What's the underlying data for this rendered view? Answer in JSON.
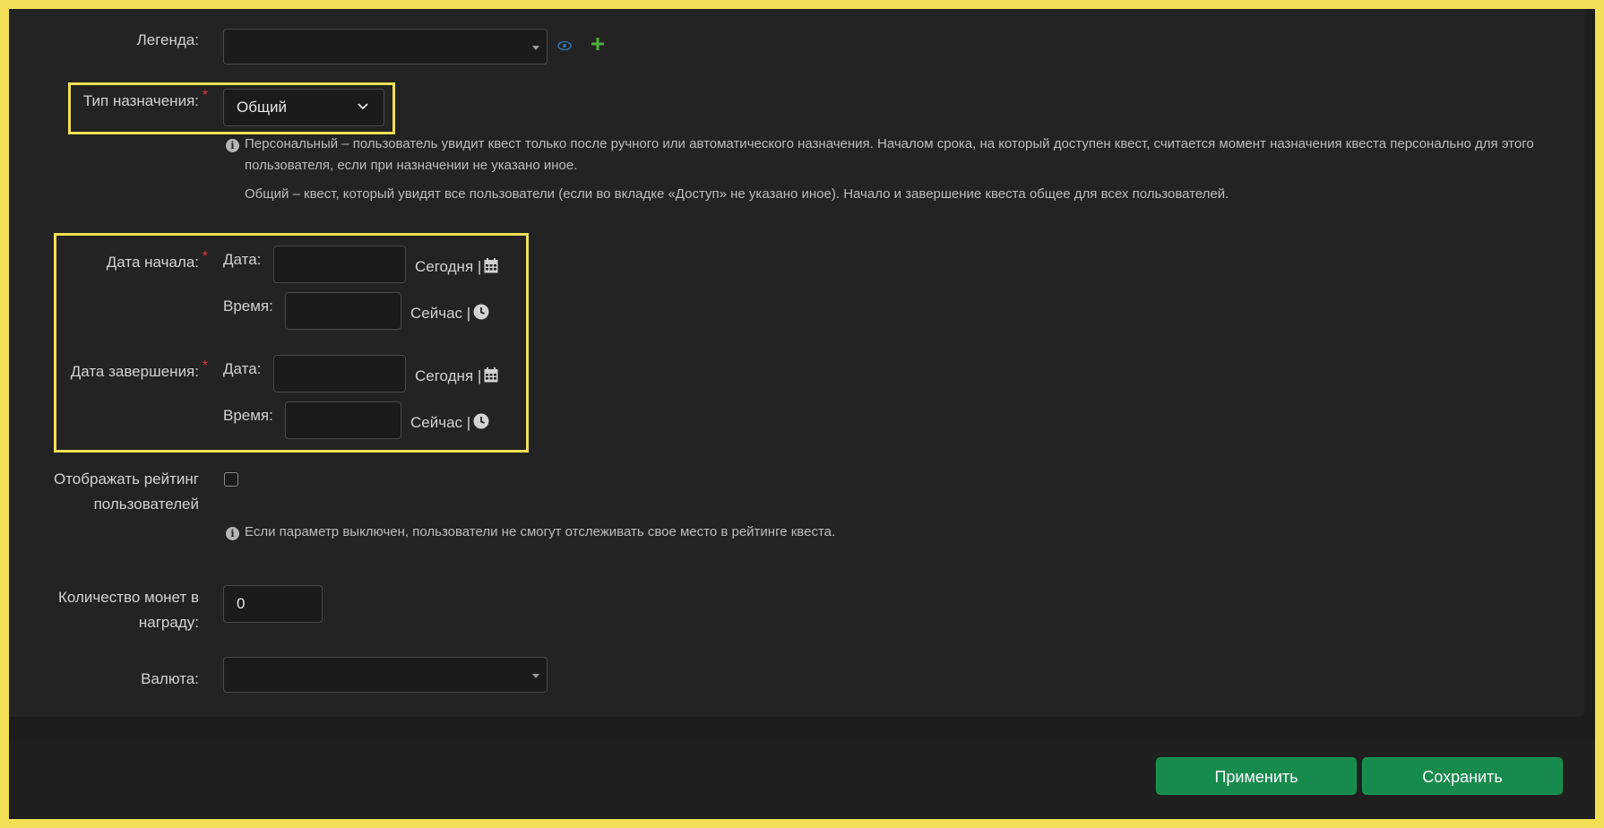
{
  "form": {
    "legend": {
      "label": "Легенда:",
      "value": ""
    },
    "assignment_type": {
      "label": "Тип назначения:",
      "required_mark": "*",
      "value": "Общий"
    },
    "assignment_hints": {
      "personal": "Персональный – пользователь увидит квест только после ручного или автоматического назначения. Началом срока, на который доступен квест, считается момент назначения квеста персонально для этого пользователя, если при назначении не указано иное.",
      "common": "Общий – квест, который увидят все пользователи (если во вкладке «Доступ» не указано иное). Начало и завершение квеста общее для всех пользователей."
    },
    "start": {
      "label": "Дата начала:",
      "required_mark": "*",
      "date_label": "Дата:",
      "time_label": "Время:",
      "today_link": "Сегодня |",
      "now_link": "Сейчас |",
      "date_value": "",
      "time_value": ""
    },
    "end": {
      "label": "Дата завершения:",
      "required_mark": "*",
      "date_label": "Дата:",
      "time_label": "Время:",
      "today_link": "Сегодня |",
      "now_link": "Сейчас |",
      "date_value": "",
      "time_value": ""
    },
    "rating": {
      "label_line1": "Отображать рейтинг",
      "label_line2": "пользователей",
      "checked": false,
      "hint": "Если параметр выключен, пользователи не смогут отслеживать свое место в рейтинге квеста."
    },
    "coins": {
      "label_line1": "Количество монет в",
      "label_line2": "награду:",
      "value": "0"
    },
    "currency": {
      "label": "Валюта:",
      "value": ""
    }
  },
  "footer": {
    "apply_label": "Применить",
    "save_label": "Сохранить"
  },
  "colors": {
    "accent_green": "#178a4d",
    "highlight_yellow": "#f3df55",
    "required_red": "#e03a3a"
  },
  "icons": [
    "eye-icon",
    "plus-icon",
    "chevron-down-icon",
    "info-icon",
    "calendar-icon",
    "clock-icon"
  ]
}
